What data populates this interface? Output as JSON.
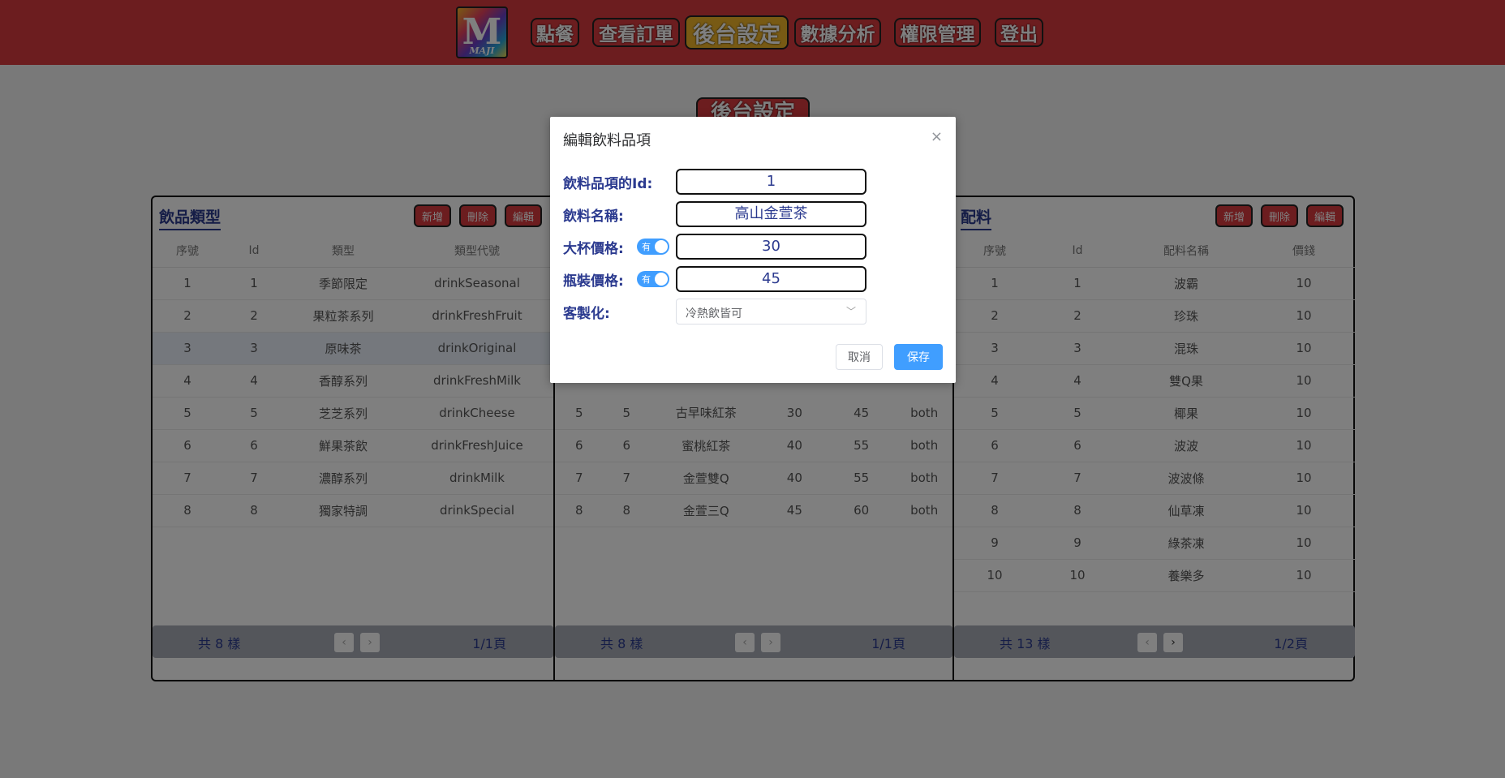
{
  "logo": {
    "letter": "M",
    "sub": "MAJI"
  },
  "nav": [
    {
      "label": "點餐"
    },
    {
      "label": "查看訂單"
    },
    {
      "label": "後台設定"
    },
    {
      "label": "數據分析"
    },
    {
      "label": "權限管理"
    },
    {
      "label": "登出"
    }
  ],
  "page_title": "後台設定",
  "panels": {
    "drink_types": {
      "title": "飲品類型",
      "buttons": {
        "add": "新增",
        "delete": "刪除",
        "edit": "編輯"
      },
      "headers": [
        "序號",
        "Id",
        "類型",
        "類型代號"
      ],
      "rows": [
        [
          "1",
          "1",
          "季節限定",
          "drinkSeasonal"
        ],
        [
          "2",
          "2",
          "果粒茶系列",
          "drinkFreshFruit"
        ],
        [
          "3",
          "3",
          "原味茶",
          "drinkOriginal"
        ],
        [
          "4",
          "4",
          "香醇系列",
          "drinkFreshMilk"
        ],
        [
          "5",
          "5",
          "芝芝系列",
          "drinkCheese"
        ],
        [
          "6",
          "6",
          "鮮果茶飲",
          "drinkFreshJuice"
        ],
        [
          "7",
          "7",
          "濃醇系列",
          "drinkMilk"
        ],
        [
          "8",
          "8",
          "獨家特調",
          "drinkSpecial"
        ]
      ],
      "count": "共 8 樣",
      "pages": "1/1頁"
    },
    "drinks": {
      "rows": [
        [
          "5",
          "5",
          "古早味紅茶",
          "30",
          "45",
          "both"
        ],
        [
          "6",
          "6",
          "蜜桃紅茶",
          "40",
          "55",
          "both"
        ],
        [
          "7",
          "7",
          "金萱雙Q",
          "40",
          "55",
          "both"
        ],
        [
          "8",
          "8",
          "金萱三Q",
          "45",
          "60",
          "both"
        ]
      ],
      "count": "共 8 樣",
      "pages": "1/1頁"
    },
    "toppings": {
      "title": "配料",
      "buttons": {
        "add": "新增",
        "delete": "刪除",
        "edit": "編輯"
      },
      "headers": [
        "序號",
        "Id",
        "配料名稱",
        "價錢"
      ],
      "rows": [
        [
          "1",
          "1",
          "波霸",
          "10"
        ],
        [
          "2",
          "2",
          "珍珠",
          "10"
        ],
        [
          "3",
          "3",
          "混珠",
          "10"
        ],
        [
          "4",
          "4",
          "雙Q果",
          "10"
        ],
        [
          "5",
          "5",
          "椰果",
          "10"
        ],
        [
          "6",
          "6",
          "波波",
          "10"
        ],
        [
          "7",
          "7",
          "波波條",
          "10"
        ],
        [
          "8",
          "8",
          "仙草凍",
          "10"
        ],
        [
          "9",
          "9",
          "綠茶凍",
          "10"
        ],
        [
          "10",
          "10",
          "養樂多",
          "10"
        ]
      ],
      "count": "共 13 樣",
      "pages": "1/2頁"
    }
  },
  "modal": {
    "title": "編輯飲料品項",
    "close": "×",
    "fields": {
      "id": {
        "label": "飲料品項的Id:",
        "value": "1"
      },
      "name": {
        "label": "飲料名稱:",
        "value": "高山金萱茶"
      },
      "large_price": {
        "label": "大杯價格:",
        "toggle": "有",
        "value": "30"
      },
      "bottle_price": {
        "label": "瓶裝價格:",
        "toggle": "有",
        "value": "45"
      },
      "custom": {
        "label": "客製化:",
        "value": "冷熱飲皆可"
      }
    },
    "cancel": "取消",
    "save": "保存"
  },
  "colors": {
    "brand_red": "#d83a3e",
    "active_gold": "#f0b429",
    "primary_blue": "#409eff",
    "label_blue": "#2b3a8f"
  },
  "icons": {
    "close": "close-icon",
    "chevron": "chevron-down-icon",
    "prev": "chevron-left-icon",
    "next": "chevron-right-icon"
  }
}
